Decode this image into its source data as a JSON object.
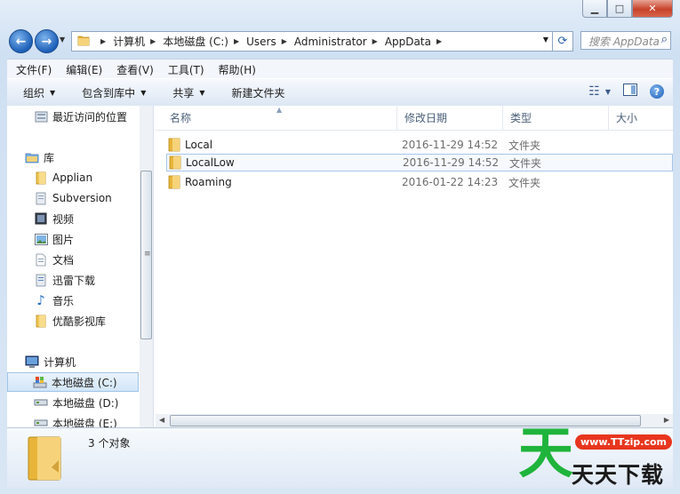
{
  "address": {
    "crumbs": [
      "计算机",
      "本地磁盘 (C:)",
      "Users",
      "Administrator",
      "AppData"
    ]
  },
  "search": {
    "placeholder": "搜索 AppData"
  },
  "menu": [
    "文件(F)",
    "编辑(E)",
    "查看(V)",
    "工具(T)",
    "帮助(H)"
  ],
  "toolbar": {
    "organize": "组织",
    "include_library": "包含到库中",
    "share": "共享",
    "new_folder": "新建文件夹"
  },
  "nav": {
    "recent": "最近访问的位置",
    "libraries": "库",
    "library_items": [
      "Applian",
      "Subversion",
      "视频",
      "图片",
      "文档",
      "迅雷下载",
      "音乐",
      "优酷影视库"
    ],
    "computer": "计算机",
    "drives": [
      "本地磁盘 (C:)",
      "本地磁盘 (D:)",
      "本地磁盘 (E:)"
    ]
  },
  "columns": {
    "name": "名称",
    "modified": "修改日期",
    "type": "类型",
    "size": "大小"
  },
  "files": [
    {
      "name": "Local",
      "modified": "2016-11-29 14:52",
      "type": "文件夹"
    },
    {
      "name": "LocalLow",
      "modified": "2016-11-29 14:52",
      "type": "文件夹"
    },
    {
      "name": "Roaming",
      "modified": "2016-01-22 14:23",
      "type": "文件夹"
    }
  ],
  "details": {
    "count": "3 个对象"
  },
  "watermark": {
    "glyph": "天",
    "url": "www.TTzip.com",
    "name": "天天下载"
  },
  "colors": {
    "folder": "#e8b53a",
    "accent": "#1c5fb8",
    "watermark_green": "#1fb43b",
    "watermark_red": "#e8361e"
  }
}
